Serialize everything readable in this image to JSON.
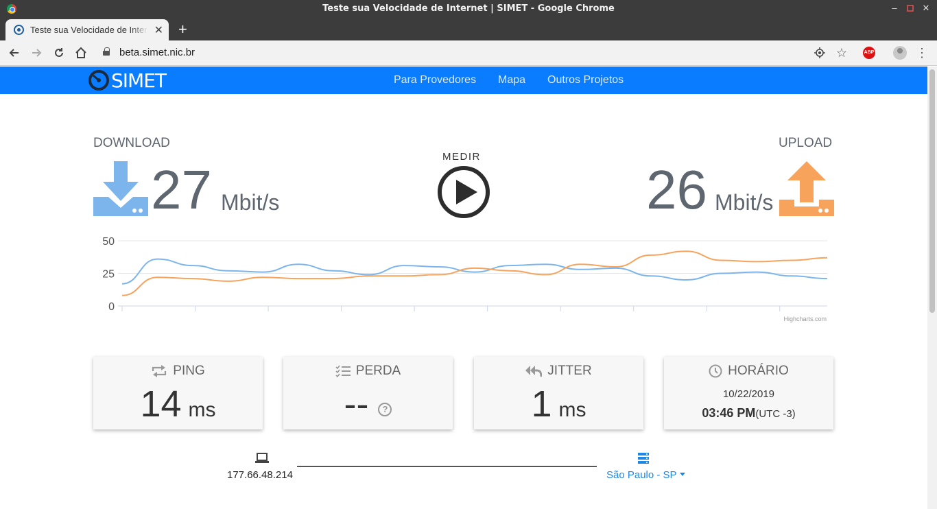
{
  "window": {
    "title": "Teste sua Velocidade de Internet | SIMET - Google Chrome"
  },
  "tab": {
    "title": "Teste sua Velocidade de Internet | SIMET"
  },
  "address_bar": {
    "url": "beta.simet.nic.br"
  },
  "extensions": {
    "abp_label": "ABP"
  },
  "nav": {
    "logo_text": "SIMET",
    "links": [
      "Para Provedores",
      "Mapa",
      "Outros Projetos"
    ]
  },
  "download": {
    "label": "DOWNLOAD",
    "value": "27",
    "unit": "Mbit/s"
  },
  "upload": {
    "label": "UPLOAD",
    "value": "26",
    "unit": "Mbit/s"
  },
  "measure_button": {
    "label": "MEDIR"
  },
  "colors": {
    "nav_bg": "#0a7cff",
    "download": "#7cb5ec",
    "upload": "#f7a35c",
    "text_gray": "#5e6670"
  },
  "chart_data": {
    "type": "line",
    "credit": "Highcharts.com",
    "ylim": [
      0,
      50
    ],
    "yticks": [
      0,
      25,
      50
    ],
    "grid": true,
    "legend": "none",
    "x": [
      0,
      1,
      2,
      3,
      4,
      5,
      6,
      7,
      8,
      9,
      10,
      11,
      12,
      13,
      14,
      15,
      16,
      17,
      18,
      19,
      20
    ],
    "series": [
      {
        "color": "#7cb5ec",
        "values": [
          17,
          36,
          31,
          27,
          26,
          32,
          27,
          24,
          31,
          30,
          26,
          31,
          32,
          28,
          29,
          23,
          20,
          25,
          26,
          23,
          21
        ]
      },
      {
        "color": "#f7a35c",
        "values": [
          8,
          22,
          21,
          19,
          22,
          21,
          21,
          23,
          23,
          24,
          29,
          27,
          24,
          32,
          30,
          39,
          42,
          35,
          34,
          35,
          37
        ]
      }
    ]
  },
  "metrics": {
    "ping": {
      "label": "PING",
      "value": "14",
      "unit": "ms"
    },
    "perda": {
      "label": "PERDA",
      "value": "--",
      "help": "?"
    },
    "jitter": {
      "label": "JITTER",
      "value": "1",
      "unit": "ms"
    },
    "horario": {
      "label": "HORÁRIO",
      "date": "10/22/2019",
      "time": "03:46 PM",
      "tz": "(UTC -3)"
    }
  },
  "connection": {
    "ip": "177.66.48.214",
    "server": "São Paulo - SP"
  }
}
